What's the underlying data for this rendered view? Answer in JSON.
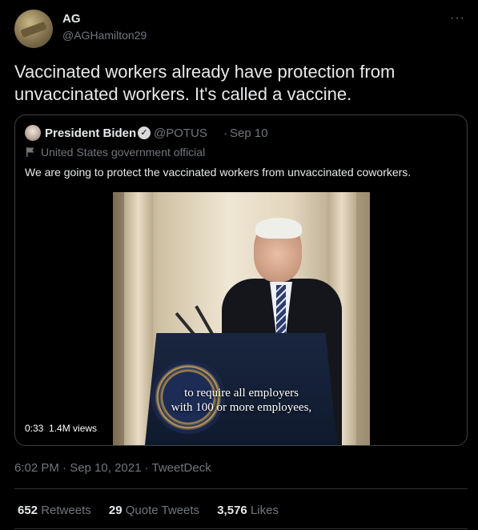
{
  "author": {
    "name": "AG",
    "handle": "@AGHamilton29"
  },
  "more_label": "···",
  "tweet_text": "Vaccinated workers already have protection from unvaccinated workers. It's called a vaccine.",
  "quoted": {
    "name": "President Biden",
    "verified_icon": "verified-badge-icon",
    "handle": "@POTUS",
    "separator": "·",
    "date": "Sep 10",
    "label": "United States government official",
    "text": "We are going to protect the vaccinated workers from unvaccinated coworkers.",
    "video": {
      "caption_line1": "to require all employers",
      "caption_line2": "with 100 or more employees,",
      "duration": "0:33",
      "views": "1.4M views"
    }
  },
  "timestamp": "6:02 PM · Sep 10, 2021 · TweetDeck",
  "stats": {
    "retweets_count": "652",
    "retweets_label": "Retweets",
    "quotes_count": "29",
    "quotes_label": "Quote Tweets",
    "likes_count": "3,576",
    "likes_label": "Likes"
  },
  "colors": {
    "background": "#000000",
    "text": "#e7e9ea",
    "muted": "#71767b",
    "border": "#2f3336"
  }
}
